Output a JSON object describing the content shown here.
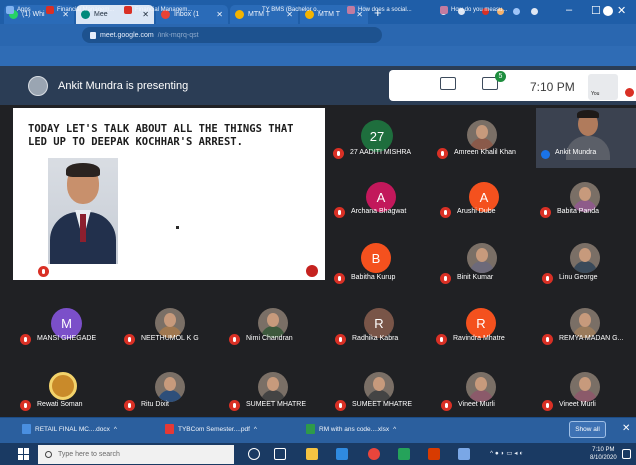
{
  "browser": {
    "tabs": [
      {
        "label": "(1) Whi",
        "active": false
      },
      {
        "label": "Mee",
        "active": true
      },
      {
        "label": "Inbox (1",
        "active": false
      },
      {
        "label": "MTM T",
        "active": false
      },
      {
        "label": "MTM T",
        "active": false
      }
    ],
    "new_tab": "+",
    "window_controls": [
      "–",
      "☐",
      "✕"
    ],
    "url_domain": "meet.google.com",
    "url_path": "/ink-mqrq-qst",
    "bookmarks": [
      "Apps",
      "Financial Managem...",
      "Financial Managem...",
      "TY BMS (Bachelor o...",
      "How does a social...",
      "How do you measu..."
    ]
  },
  "meet": {
    "presenting_text": "Ankit Mundra is presenting",
    "participant_badge": "5",
    "time": "7:10 PM",
    "you_label": "You",
    "slide": {
      "text": "TODAY LET'S TALK ABOUT ALL THE THINGS THAT LED UP TO DEEPAK KOCHHAR'S ARREST.",
      "presenter_caption": "Ankit Mundra"
    },
    "participants": [
      {
        "name": "27 AADITI MISHRA",
        "initial": "27",
        "color": "#1e6e3d"
      },
      {
        "name": "Amreen Khalil Khan",
        "initial": "",
        "color": "#8a5a4a"
      },
      {
        "name": "Ankit Mundra",
        "initial": "",
        "color": "#5b5f68"
      },
      {
        "name": "Archana Bhagwat",
        "initial": "A",
        "color": "#c2185b"
      },
      {
        "name": "Arushi Dube",
        "initial": "A",
        "color": "#f4511e"
      },
      {
        "name": "Babita Panda",
        "initial": "",
        "color": "#8e5b8a"
      },
      {
        "name": "Babitha Kurup",
        "initial": "B",
        "color": "#f4511e"
      },
      {
        "name": "Binit Kumar",
        "initial": "",
        "color": "#6d6a7a"
      },
      {
        "name": "Linu George",
        "initial": "",
        "color": "#3a4a5a"
      },
      {
        "name": "MANSI GHEGADE",
        "initial": "M",
        "color": "#7b4fc9"
      },
      {
        "name": "NEETHUMOL K G",
        "initial": "",
        "color": "#a07850"
      },
      {
        "name": "Nimi Chandran",
        "initial": "",
        "color": "#3d5a3d"
      },
      {
        "name": "Radhika Kabra",
        "initial": "R",
        "color": "#795548"
      },
      {
        "name": "Ravindra Mhatre",
        "initial": "R",
        "color": "#f4511e"
      },
      {
        "name": "REMYA MADAN G...",
        "initial": "",
        "color": "#9a7b5c"
      },
      {
        "name": "Rewati Soman",
        "initial": "",
        "color": "#c98a2a"
      },
      {
        "name": "Ritu Dixit",
        "initial": "",
        "color": "#2e4f7a"
      },
      {
        "name": "SUMEET MHATRE",
        "initial": "",
        "color": "#444444"
      },
      {
        "name": "SUMEET MHATRE",
        "initial": "",
        "color": "#444444"
      },
      {
        "name": "Vineet Murli",
        "initial": "",
        "color": "#8b5a6a"
      },
      {
        "name": "Vineet Murli",
        "initial": "",
        "color": "#8b5a6a"
      }
    ]
  },
  "downloads": {
    "items": [
      "RETAIL FINAL MC....docx",
      "TYBCom Semester....pdf",
      "RM with ans code....xlsx"
    ],
    "show_all": "Show all",
    "close": "✕"
  },
  "taskbar": {
    "search_placeholder": "Type here to search",
    "time": "7:10 PM",
    "date": "8/10/2020"
  }
}
